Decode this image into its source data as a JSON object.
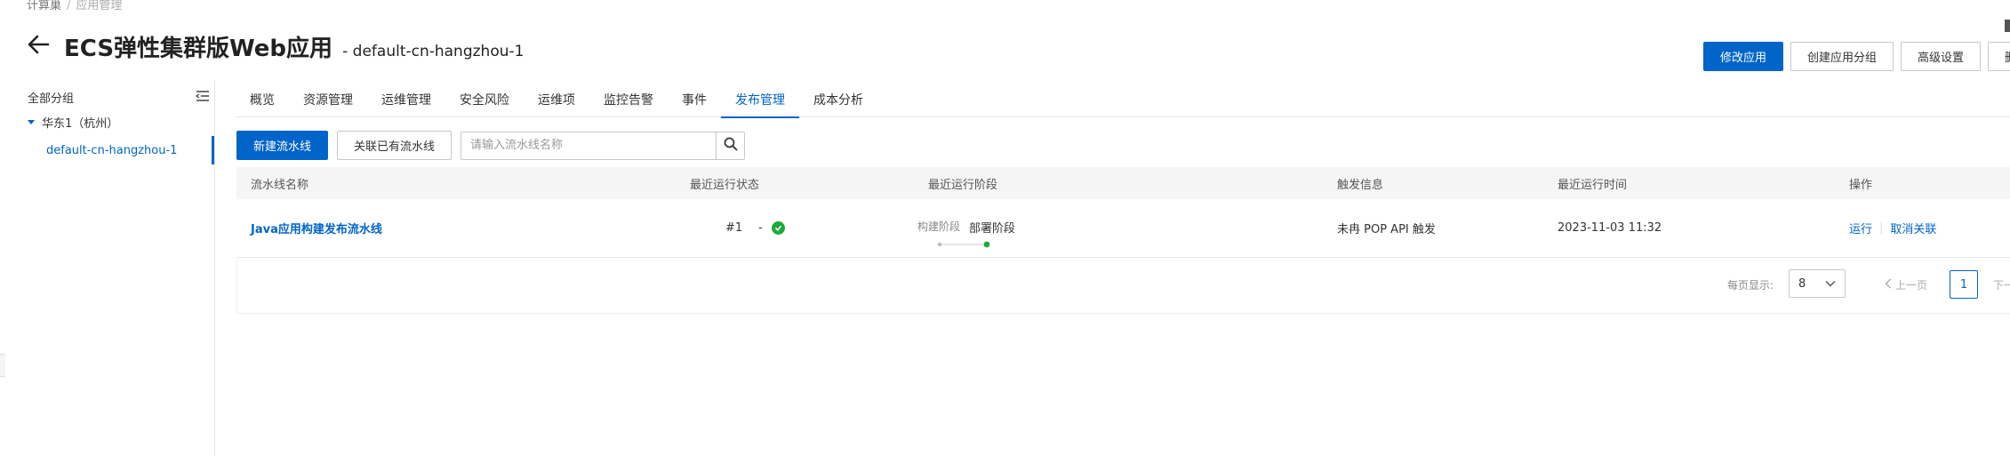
{
  "breadcrumb": {
    "items": [
      "计算巢",
      "应用管理"
    ],
    "separator": "/"
  },
  "page": {
    "title": "ECS弹性集群版Web应用",
    "subtitle": "- default-cn-hangzhou-1"
  },
  "header_actions": {
    "modify": "修改应用",
    "create_group": "创建应用分组",
    "advanced": "高级设置",
    "delete": "删除应"
  },
  "sidebar": {
    "header": "全部分组",
    "region": "华东1（杭州）",
    "item": "default-cn-hangzhou-1"
  },
  "tabs": [
    {
      "label": "概览",
      "active": false
    },
    {
      "label": "资源管理",
      "active": false
    },
    {
      "label": "运维管理",
      "active": false
    },
    {
      "label": "安全风险",
      "active": false
    },
    {
      "label": "运维项",
      "active": false
    },
    {
      "label": "监控告警",
      "active": false
    },
    {
      "label": "事件",
      "active": false
    },
    {
      "label": "发布管理",
      "active": true
    },
    {
      "label": "成本分析",
      "active": false
    }
  ],
  "toolbar": {
    "new_pipeline": "新建流水线",
    "link_pipeline": "关联已有流水线",
    "search_placeholder": "请输入流水线名称"
  },
  "table": {
    "headers": {
      "name": "流水线名称",
      "status": "最近运行状态",
      "stage": "最近运行阶段",
      "trigger": "触发信息",
      "time": "最近运行时间",
      "ops": "操作"
    },
    "rows": [
      {
        "name": "Java应用构建发布流水线",
        "run_no": "#1",
        "run_dash": "-",
        "stage_done": "构建阶段",
        "stage_current": "部署阶段",
        "trigger": "未冉 POP API 触发",
        "time": "2023-11-03 11:32",
        "op_run": "运行",
        "op_unlink": "取消关联"
      }
    ]
  },
  "pagination": {
    "page_size_label": "每页显示:",
    "page_size": "8",
    "prev": "上一页",
    "current": "1",
    "next": "下一"
  },
  "colors": {
    "primary": "#0064c8",
    "success": "#1ea93b"
  }
}
